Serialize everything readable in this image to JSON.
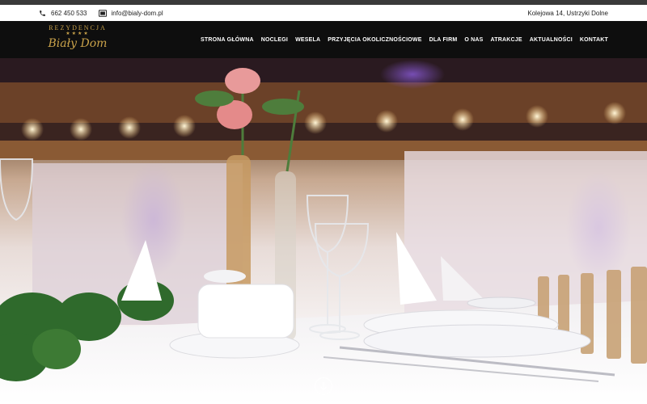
{
  "contact": {
    "phone": "662 450 533",
    "email": "info@bialy-dom.pl",
    "address": "Kolejowa 14, Ustrzyki Dolne"
  },
  "logo": {
    "top_text": "REZYDENCJA",
    "stars": "★★★★",
    "script_text": "Biały Dom"
  },
  "nav": {
    "items": [
      {
        "label": "STRONA GŁÓWNA"
      },
      {
        "label": "NOCLEGI"
      },
      {
        "label": "WESELA"
      },
      {
        "label": "PRZYJĘCIA OKOLICZNOŚCIOWE"
      },
      {
        "label": "DLA FIRM"
      },
      {
        "label": "O NAS"
      },
      {
        "label": "ATRAKCJE"
      },
      {
        "label": "AKTUALNOŚCI"
      },
      {
        "label": "KONTAKT"
      }
    ]
  },
  "colors": {
    "brand_gold": "#c9a24a",
    "nav_bg": "#0e0e0e"
  },
  "icons": {
    "phone": "phone-icon",
    "email": "email-icon",
    "scroll": "arrow-down-icon"
  }
}
